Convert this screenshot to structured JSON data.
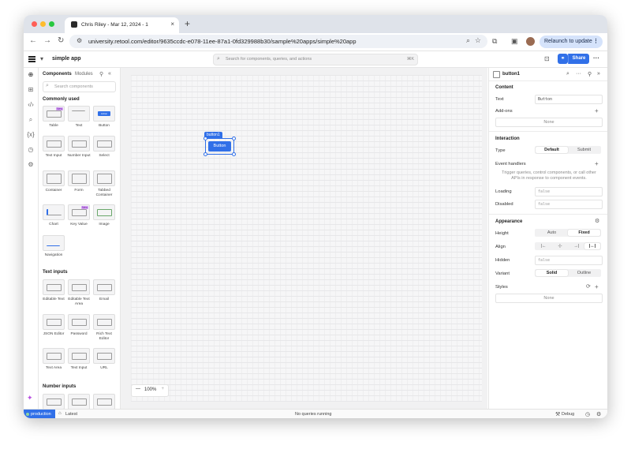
{
  "browser": {
    "tab_title": "Chris Riley - Mar 12, 2024 - 1",
    "tab_close": "×",
    "new_tab": "+",
    "url": "university.retool.com/editor/9635ccdc-e078-11ee-87a1-0fd329988b30/sample%20apps/simple%20app",
    "relaunch_label": "Relaunch to update",
    "relaunch_more": "⋮",
    "back": "←",
    "forward": "→",
    "reload": "↻"
  },
  "app": {
    "name": "simple app",
    "search_placeholder": "Search for components, queries, and actions",
    "search_shortcut": "⌘K",
    "share_label": "Share",
    "more": "···"
  },
  "components_panel": {
    "tabs": [
      "Components",
      "Modules"
    ],
    "search_placeholder": "Search components",
    "sections": [
      {
        "title": "Commonly used",
        "items": [
          "Table",
          "Text",
          "Button",
          "Text Input",
          "Number Input",
          "Select",
          "Container",
          "Form",
          "Tabbed Container",
          "Chart",
          "Key Value",
          "Image",
          "Navigation"
        ]
      },
      {
        "title": "Text inputs",
        "items": [
          "Editable Text",
          "Editable Text Area",
          "Email",
          "JSON Editor",
          "Password",
          "Rich Text Editor",
          "Text Area",
          "Text Input",
          "URL"
        ]
      },
      {
        "title": "Number inputs",
        "items": []
      }
    ],
    "new_badge": "New",
    "button_thumb_text": "Action"
  },
  "canvas": {
    "selected_tag": "button1",
    "button_text": "Button",
    "zoom": "100%",
    "zoom_minus": "—",
    "zoom_plus": "+"
  },
  "inspector": {
    "component_name": "button1",
    "content": {
      "title": "Content",
      "text_label": "Text",
      "text_value": "Button",
      "addons_label": "Add-ons",
      "addons_value": "None"
    },
    "interaction": {
      "title": "Interaction",
      "type_label": "Type",
      "type_options": [
        "Default",
        "Submit"
      ],
      "type_selected": "Default",
      "event_handlers_label": "Event handlers",
      "event_handlers_hint": "Trigger queries, control components, or call other APIs in response to component events.",
      "loading_label": "Loading",
      "loading_value": "false",
      "disabled_label": "Disabled",
      "disabled_value": "false"
    },
    "appearance": {
      "title": "Appearance",
      "height_label": "Height",
      "height_options": [
        "Auto",
        "Fixed"
      ],
      "height_selected": "Fixed",
      "align_label": "Align",
      "align_options": [
        "|←",
        "-|-",
        "→|",
        "|↔|"
      ],
      "hidden_label": "Hidden",
      "hidden_value": "false",
      "variant_label": "Variant",
      "variant_options": [
        "Solid",
        "Outline"
      ],
      "variant_selected": "Solid",
      "styles_label": "Styles",
      "styles_value": "None"
    }
  },
  "footer": {
    "environment": "production",
    "version": "Latest",
    "status": "No queries running",
    "debug": "Debug"
  },
  "colors": {
    "accent": "#3170e8",
    "canvas_bg": "#f1f1f2",
    "tabstrip": "#dfe3ea",
    "relaunch_bg": "#d5e3fb",
    "new_badge": "#d7a5f7"
  }
}
